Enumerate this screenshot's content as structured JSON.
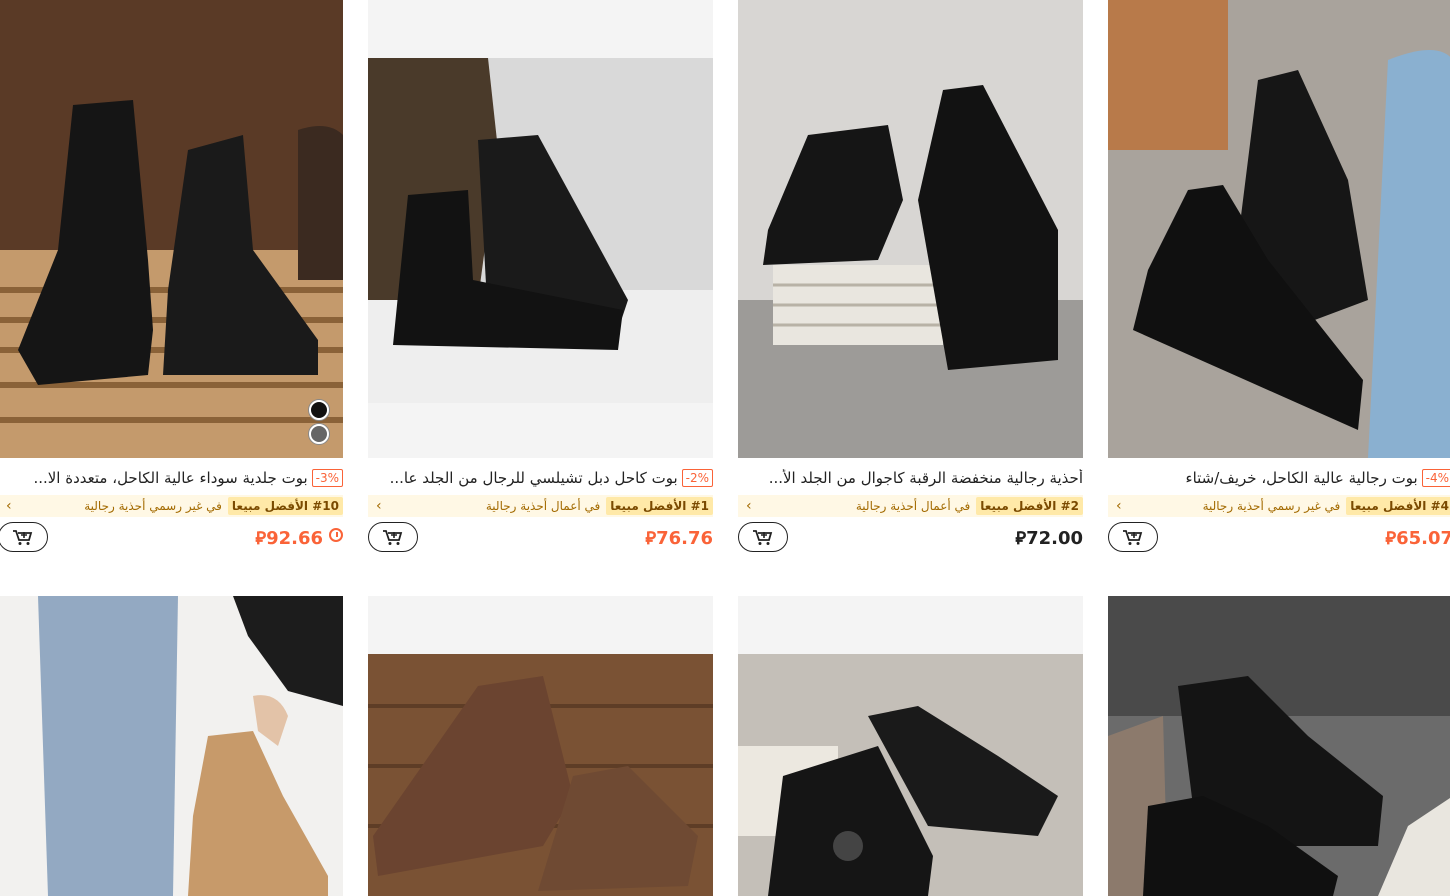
{
  "currency_symbol": "⃁",
  "products": [
    {
      "discount": "-3%",
      "title": "بوت جلدية سوداء عالية الكاحل، متعددة الا...",
      "rank": "#10 الأفضل مبيعا",
      "category": "في غير رسمي أحذية رجالية",
      "price": "92.66",
      "add_to_cart_icon": "cart-plus-icon"
    },
    {
      "discount": "-2%",
      "title": "بوت كاحل دبل تشيلسي للرجال من الجلد عا...",
      "rank": "#1 الأفضل مبيعا",
      "category": "في أعمال أحذية رجالية",
      "price": "76.76",
      "add_to_cart_icon": "cart-plus-icon"
    },
    {
      "discount": "",
      "title": "أحذية رجالية منخفضة الرقبة كاجوال من الجلد الأ...",
      "rank": "#2 الأفضل مبيعا",
      "category": "في أعمال أحذية رجالية",
      "price": "72.00",
      "add_to_cart_icon": "cart-plus-icon"
    },
    {
      "discount": "-4%",
      "title": "بوت رجالية عالية الكاحل، خريف/شتاء",
      "rank": "#4 الأفضل مبيعا",
      "category": "في غير رسمي أحذية رجالية",
      "price": "65.07",
      "add_to_cart_icon": "cart-plus-icon"
    }
  ],
  "colors": {
    "accent": "#fa6338",
    "rank_bg": "#ffe9a8",
    "rank_row_bg": "#fff8e5"
  }
}
